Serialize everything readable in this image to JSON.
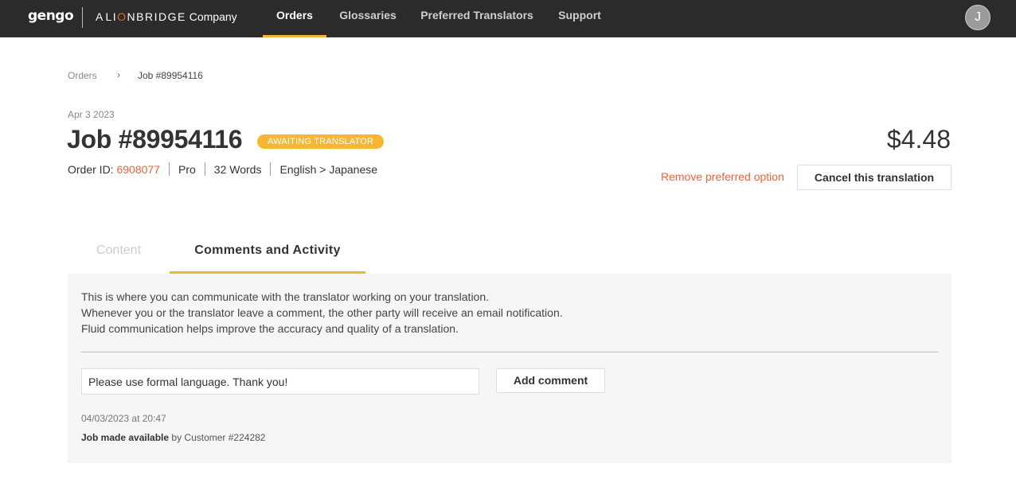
{
  "nav": {
    "logo": "gengo",
    "company_prefix": "A",
    "company_brand_pre": "LI",
    "company_brand_accent": "O",
    "company_brand_post": "NBRIDGE",
    "company_suffix": "Company",
    "items": [
      {
        "label": "Orders",
        "active": true
      },
      {
        "label": "Glossaries",
        "active": false
      },
      {
        "label": "Preferred Translators",
        "active": false
      },
      {
        "label": "Support",
        "active": false
      }
    ],
    "avatar_initial": "J"
  },
  "breadcrumb": {
    "root": "Orders",
    "separator": "›",
    "current": "Job #89954116"
  },
  "job": {
    "date": "Apr 3 2023",
    "title": "Job #89954116",
    "status": "AWAITING TRANSLATOR",
    "order_id_label": "Order ID:",
    "order_id": "6908077",
    "tier": "Pro",
    "words": "32 Words",
    "languages": "English > Japanese",
    "price": "$4.48",
    "remove_preferred_label": "Remove preferred option",
    "cancel_label": "Cancel this translation"
  },
  "tabs": [
    {
      "label": "Content",
      "active": false
    },
    {
      "label": "Comments and Activity",
      "active": true
    }
  ],
  "comments": {
    "info": [
      "This is where you can communicate with the translator working on your translation.",
      "Whenever you or the translator leave a comment, the other party will receive an email notification.",
      "Fluid communication helps improve the accuracy and quality of a translation."
    ],
    "input_value": "Please use formal language. Thank you!",
    "add_label": "Add comment",
    "activity": {
      "timestamp": "04/03/2023 at 20:47",
      "action": "Job made available",
      "by": "by Customer #224282"
    }
  },
  "colors": {
    "topbar": "#2b2b2b",
    "accent_yellow": "#f5b335",
    "accent_orange": "#e8643a"
  }
}
